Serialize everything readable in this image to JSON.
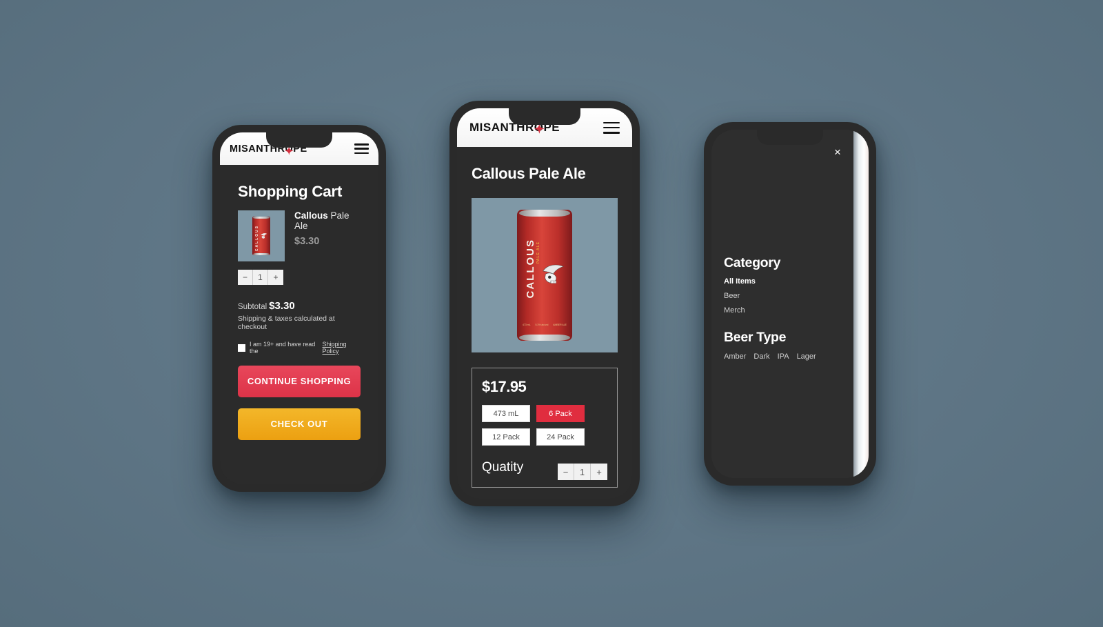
{
  "background_color": "#627a89",
  "brand": {
    "logo_text": "MISANTHROPE",
    "logo_mark": "Q",
    "accent_red": "#e02d3f",
    "accent_gold": "#eca011",
    "dark_bg": "#2b2b2b"
  },
  "phone1": {
    "header": {
      "logo": "MISANTHROPE",
      "menu_icon": "hamburger-icon"
    },
    "cart": {
      "title": "Shopping Cart",
      "item": {
        "name_bold": "Callous",
        "name_rest": "Pale Ale",
        "price": "$3.30",
        "thumb_label": "CALLOUS"
      },
      "quantity": {
        "minus": "−",
        "value": "1",
        "plus": "+"
      },
      "subtotal_label": "Subtotal",
      "subtotal_value": "$3.30",
      "shipping_note": "Shipping & taxes calculated at checkout",
      "agree_text": "I am 19+ and have read the",
      "agree_link": "Shipping Policy",
      "continue_button": "CONTINUE SHOPPING",
      "checkout_button": "CHECK OUT"
    }
  },
  "phone2": {
    "header": {
      "logo": "MISANTHROPE",
      "menu_icon": "hamburger-icon"
    },
    "product": {
      "title": "Callous Pale Ale",
      "image_label": "CALLOUS",
      "image_sub": "PALE ALE",
      "can_volume": "473 mL",
      "can_abv": "5.3% alc/vol",
      "can_origin": "AMBER ALE",
      "price": "$17.95",
      "variants": [
        {
          "label": "473 mL",
          "selected": false
        },
        {
          "label": "6 Pack",
          "selected": true
        },
        {
          "label": "12 Pack",
          "selected": false
        },
        {
          "label": "24 Pack",
          "selected": false
        }
      ],
      "quantity_label": "Quatity",
      "quantity": {
        "minus": "−",
        "value": "1",
        "plus": "+"
      }
    }
  },
  "phone3": {
    "drawer": {
      "close_icon": "×",
      "category_heading": "Category",
      "category_items": [
        {
          "label": "All Items",
          "active": true
        },
        {
          "label": "Beer",
          "active": false
        },
        {
          "label": "Merch",
          "active": false
        }
      ],
      "beer_type_heading": "Beer Type",
      "beer_types": [
        "Amber",
        "Dark",
        "IPA",
        "Lager"
      ]
    }
  }
}
